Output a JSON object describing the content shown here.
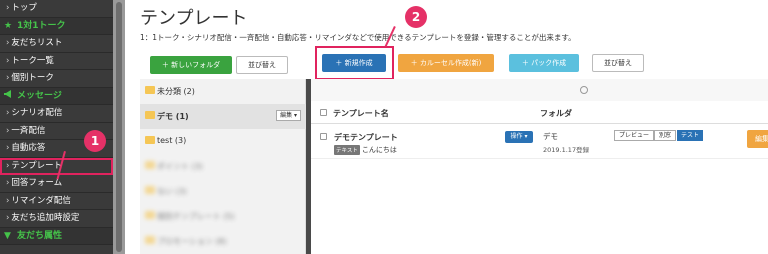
{
  "sidebar": {
    "items": [
      {
        "label": "トップ",
        "type": "item"
      },
      {
        "label": "1対1トーク",
        "type": "head",
        "icon": "star-icon"
      },
      {
        "label": "友だちリスト",
        "type": "item"
      },
      {
        "label": "トーク一覧",
        "type": "item"
      },
      {
        "label": "個別トーク",
        "type": "item"
      },
      {
        "label": "メッセージ",
        "type": "head",
        "icon": "megaphone-icon"
      },
      {
        "label": "シナリオ配信",
        "type": "item"
      },
      {
        "label": "一斉配信",
        "type": "item"
      },
      {
        "label": "自動応答",
        "type": "item"
      },
      {
        "label": "テンプレート",
        "type": "item",
        "active": true
      },
      {
        "label": "回答フォーム",
        "type": "item"
      },
      {
        "label": "リマインダ配信",
        "type": "item"
      },
      {
        "label": "友だち追加時設定",
        "type": "item"
      },
      {
        "label": "友だち属性",
        "type": "head",
        "icon": "filter-icon"
      }
    ]
  },
  "annotations": {
    "badge1": "1",
    "badge2": "2"
  },
  "main": {
    "title": "テンプレート",
    "description": "1：1トーク・シナリオ配信・一斉配信・自動応答・リマインダなどで使用できるテンプレートを登録・管理することが出来ます。",
    "buttons": {
      "new_folder": "新しいフォルダ",
      "sort1": "並び替え",
      "new_create": "新規作成",
      "carousel": "カルーセル作成(新)",
      "pack": "パック作成",
      "sort2": "並び替え"
    }
  },
  "folders": [
    {
      "name": "未分類 (2)",
      "selected": false,
      "blurred": false
    },
    {
      "name": "デモ (1)",
      "selected": true,
      "blurred": false,
      "edit_label": "編集"
    },
    {
      "name": "test (3)",
      "selected": false,
      "blurred": false
    },
    {
      "name": "ポイント (3)",
      "selected": false,
      "blurred": true
    },
    {
      "name": "ない (3)",
      "selected": false,
      "blurred": true
    },
    {
      "name": "個別テンプレート (5)",
      "selected": false,
      "blurred": true
    },
    {
      "name": "プロモーション (8)",
      "selected": false,
      "blurred": true
    }
  ],
  "table": {
    "headers": {
      "name": "テンプレート名",
      "folder": "フォルダ"
    },
    "rows": [
      {
        "name": "デモテンプレート",
        "tag": "テキスト",
        "preview_text": "こんにちは",
        "action_label": "操作",
        "folder": "デモ",
        "date": "2019.1.17登録",
        "buttons": {
          "preview": "プレビュー",
          "separate": "別窓",
          "test": "テスト",
          "edit": "編集"
        }
      }
    ]
  },
  "colors": {
    "accent": "#e0235e",
    "green": "#45c34a",
    "blue": "#2a72b5",
    "orange": "#f0a540"
  }
}
